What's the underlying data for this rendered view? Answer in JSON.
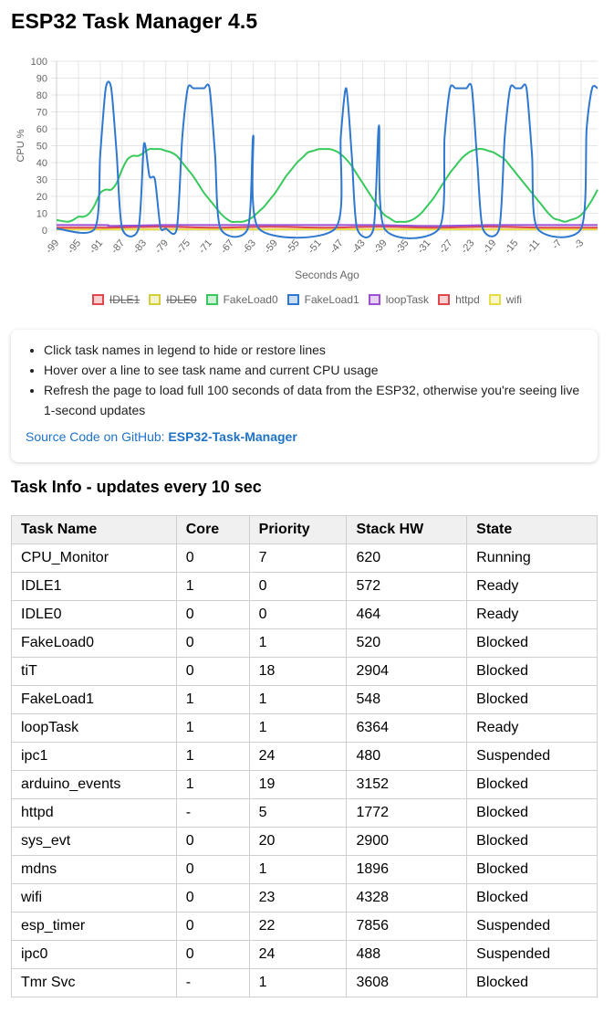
{
  "title": "ESP32 Task Manager 4.5",
  "chart_data": {
    "type": "line",
    "ylabel": "CPU %",
    "xlabel": "Seconds Ago",
    "ylim": [
      0,
      100
    ],
    "yticks": [
      0,
      10,
      20,
      30,
      40,
      50,
      60,
      70,
      80,
      90,
      100
    ],
    "xticks": [
      "-99",
      "-95",
      "-91",
      "-87",
      "-83",
      "-79",
      "-75",
      "-71",
      "-67",
      "-63",
      "-59",
      "-55",
      "-51",
      "-47",
      "-43",
      "-39",
      "-35",
      "-31",
      "-27",
      "-23",
      "-19",
      "-15",
      "-11",
      "-7",
      "-3"
    ],
    "x_start": -99,
    "x_end": 0,
    "series": [
      {
        "name": "IDLE1",
        "color": "#e0474c",
        "hidden": true
      },
      {
        "name": "IDLE0",
        "color": "#d6cf3c",
        "hidden": true
      },
      {
        "name": "FakeLoad0",
        "color": "#37c95c",
        "hidden": false,
        "points": [
          [
            -99,
            6
          ],
          [
            -97,
            5
          ],
          [
            -96,
            6
          ],
          [
            -95,
            8
          ],
          [
            -94,
            8
          ],
          [
            -93,
            10
          ],
          [
            -92,
            15
          ],
          [
            -91,
            22
          ],
          [
            -90,
            24
          ],
          [
            -89,
            24
          ],
          [
            -88,
            28
          ],
          [
            -87,
            36
          ],
          [
            -86,
            42
          ],
          [
            -85,
            44
          ],
          [
            -84,
            44
          ],
          [
            -83,
            46
          ],
          [
            -82,
            48
          ],
          [
            -81,
            48
          ],
          [
            -80,
            48
          ],
          [
            -79,
            47
          ],
          [
            -78,
            46
          ],
          [
            -77,
            44
          ],
          [
            -76,
            40
          ],
          [
            -75,
            36
          ],
          [
            -74,
            32
          ],
          [
            -73,
            27
          ],
          [
            -72,
            22
          ],
          [
            -71,
            18
          ],
          [
            -70,
            14
          ],
          [
            -69,
            10
          ],
          [
            -68,
            7
          ],
          [
            -67,
            5
          ],
          [
            -66,
            5
          ],
          [
            -65,
            5
          ],
          [
            -64,
            6
          ],
          [
            -63,
            8
          ],
          [
            -62,
            11
          ],
          [
            -61,
            14
          ],
          [
            -60,
            18
          ],
          [
            -59,
            22
          ],
          [
            -58,
            27
          ],
          [
            -57,
            32
          ],
          [
            -56,
            36
          ],
          [
            -55,
            40
          ],
          [
            -54,
            43
          ],
          [
            -53,
            46
          ],
          [
            -52,
            47
          ],
          [
            -51,
            48
          ],
          [
            -50,
            48
          ],
          [
            -49,
            48
          ],
          [
            -48,
            47
          ],
          [
            -47,
            45
          ],
          [
            -46,
            42
          ],
          [
            -45,
            38
          ],
          [
            -44,
            33
          ],
          [
            -43,
            28
          ],
          [
            -42,
            23
          ],
          [
            -41,
            18
          ],
          [
            -40,
            13
          ],
          [
            -39,
            9
          ],
          [
            -38,
            7
          ],
          [
            -37,
            5
          ],
          [
            -36,
            5
          ],
          [
            -35,
            5
          ],
          [
            -34,
            6
          ],
          [
            -33,
            8
          ],
          [
            -32,
            11
          ],
          [
            -31,
            15
          ],
          [
            -30,
            19
          ],
          [
            -29,
            24
          ],
          [
            -28,
            29
          ],
          [
            -27,
            34
          ],
          [
            -26,
            38
          ],
          [
            -25,
            42
          ],
          [
            -24,
            45
          ],
          [
            -23,
            47
          ],
          [
            -22,
            48
          ],
          [
            -21,
            48
          ],
          [
            -20,
            47
          ],
          [
            -19,
            46
          ],
          [
            -18,
            44
          ],
          [
            -17,
            42
          ],
          [
            -16,
            38
          ],
          [
            -15,
            34
          ],
          [
            -14,
            30
          ],
          [
            -13,
            26
          ],
          [
            -12,
            22
          ],
          [
            -11,
            18
          ],
          [
            -10,
            14
          ],
          [
            -9,
            10
          ],
          [
            -8,
            7
          ],
          [
            -7,
            6
          ],
          [
            -6,
            5
          ],
          [
            -5,
            6
          ],
          [
            -4,
            7
          ],
          [
            -3,
            9
          ],
          [
            -2,
            13
          ],
          [
            -1,
            18
          ],
          [
            0,
            24
          ]
        ]
      },
      {
        "name": "FakeLoad1",
        "color": "#2f78cf",
        "hidden": false,
        "points": [
          [
            -99,
            1
          ],
          [
            -92,
            1
          ],
          [
            -91,
            45
          ],
          [
            -90,
            84
          ],
          [
            -89,
            84
          ],
          [
            -88,
            45
          ],
          [
            -87,
            1
          ],
          [
            -84,
            1
          ],
          [
            -83,
            51
          ],
          [
            -82,
            32
          ],
          [
            -81,
            30
          ],
          [
            -80,
            2
          ],
          [
            -79,
            1
          ],
          [
            -77,
            1
          ],
          [
            -76,
            55
          ],
          [
            -75,
            84
          ],
          [
            -74,
            84
          ],
          [
            -73,
            84
          ],
          [
            -72,
            84
          ],
          [
            -71,
            84
          ],
          [
            -70,
            45
          ],
          [
            -69,
            1
          ],
          [
            -64,
            1
          ],
          [
            -63,
            56
          ],
          [
            -62,
            1
          ],
          [
            -48,
            1
          ],
          [
            -47,
            55
          ],
          [
            -46,
            84
          ],
          [
            -45,
            45
          ],
          [
            -44,
            1
          ],
          [
            -41,
            1
          ],
          [
            -40,
            62
          ],
          [
            -39,
            1
          ],
          [
            -29,
            1
          ],
          [
            -28,
            55
          ],
          [
            -27,
            84
          ],
          [
            -26,
            84
          ],
          [
            -25,
            84
          ],
          [
            -24,
            84
          ],
          [
            -23,
            84
          ],
          [
            -22,
            40
          ],
          [
            -21,
            1
          ],
          [
            -18,
            1
          ],
          [
            -17,
            55
          ],
          [
            -16,
            84
          ],
          [
            -15,
            84
          ],
          [
            -14,
            84
          ],
          [
            -13,
            84
          ],
          [
            -12,
            45
          ],
          [
            -11,
            1
          ],
          [
            -3,
            1
          ],
          [
            -2,
            60
          ],
          [
            -1,
            84
          ],
          [
            0,
            84
          ]
        ]
      },
      {
        "name": "loopTask",
        "color": "#9a4fd4",
        "hidden": false,
        "points": [
          [
            -99,
            3
          ],
          [
            -90,
            3
          ],
          [
            -89,
            2.5
          ],
          [
            -80,
            3
          ],
          [
            -70,
            3
          ],
          [
            -60,
            3
          ],
          [
            -50,
            3
          ],
          [
            -40,
            3
          ],
          [
            -30,
            2.5
          ],
          [
            -20,
            3
          ],
          [
            -10,
            3
          ],
          [
            0,
            3
          ]
        ]
      },
      {
        "name": "httpd",
        "color": "#e0474c",
        "hidden": false,
        "points": [
          [
            -99,
            1.5
          ],
          [
            -90,
            1.5
          ],
          [
            -80,
            2
          ],
          [
            -70,
            1.5
          ],
          [
            -60,
            2
          ],
          [
            -50,
            1.5
          ],
          [
            -40,
            2
          ],
          [
            -30,
            1.5
          ],
          [
            -20,
            2
          ],
          [
            -10,
            1.5
          ],
          [
            0,
            1.5
          ]
        ]
      },
      {
        "name": "wifi",
        "color": "#e6dc44",
        "hidden": false,
        "points": [
          [
            -99,
            0.5
          ],
          [
            -80,
            0.5
          ],
          [
            -60,
            0.5
          ],
          [
            -40,
            0.5
          ],
          [
            -20,
            0.5
          ],
          [
            0,
            0.5
          ]
        ]
      }
    ]
  },
  "info": {
    "bullets": [
      "Click task names in legend to hide or restore lines",
      "Hover over a line to see task name and current CPU usage",
      "Refresh the page to load full 100 seconds of data from the ESP32, otherwise you're seeing live 1-second updates"
    ],
    "source_prefix": "Source Code on GitHub: ",
    "source_link": "ESP32-Task-Manager"
  },
  "table_title": "Task Info - updates every 10 sec",
  "table": {
    "headers": [
      "Task Name",
      "Core",
      "Priority",
      "Stack HW",
      "State"
    ],
    "rows": [
      [
        "CPU_Monitor",
        "0",
        "7",
        "620",
        "Running"
      ],
      [
        "IDLE1",
        "1",
        "0",
        "572",
        "Ready"
      ],
      [
        "IDLE0",
        "0",
        "0",
        "464",
        "Ready"
      ],
      [
        "FakeLoad0",
        "0",
        "1",
        "520",
        "Blocked"
      ],
      [
        "tiT",
        "0",
        "18",
        "2904",
        "Blocked"
      ],
      [
        "FakeLoad1",
        "1",
        "1",
        "548",
        "Blocked"
      ],
      [
        "loopTask",
        "1",
        "1",
        "6364",
        "Ready"
      ],
      [
        "ipc1",
        "1",
        "24",
        "480",
        "Suspended"
      ],
      [
        "arduino_events",
        "1",
        "19",
        "3152",
        "Blocked"
      ],
      [
        "httpd",
        "-",
        "5",
        "1772",
        "Blocked"
      ],
      [
        "sys_evt",
        "0",
        "20",
        "2900",
        "Blocked"
      ],
      [
        "mdns",
        "0",
        "1",
        "1896",
        "Blocked"
      ],
      [
        "wifi",
        "0",
        "23",
        "4328",
        "Blocked"
      ],
      [
        "esp_timer",
        "0",
        "22",
        "7856",
        "Suspended"
      ],
      [
        "ipc0",
        "0",
        "24",
        "488",
        "Suspended"
      ],
      [
        "Tmr Svc",
        "-",
        "1",
        "3608",
        "Blocked"
      ]
    ]
  }
}
